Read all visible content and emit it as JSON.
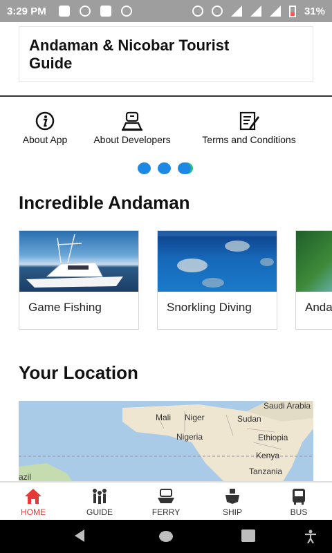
{
  "status_bar": {
    "time": "3:29 PM",
    "battery": "31%"
  },
  "header": {
    "title_line1": "Andaman & Nicobar Tourist",
    "title_line2": "Guide"
  },
  "quick_links": [
    {
      "label": "About App",
      "icon": "info-icon"
    },
    {
      "label": "About Developers",
      "icon": "developer-icon"
    },
    {
      "label": "Terms and Conditions",
      "icon": "document-edit-icon"
    }
  ],
  "pager": {
    "dot_count": 3
  },
  "sections": {
    "incredible": "Incredible Andaman",
    "location": "Your Location"
  },
  "cards": [
    {
      "label": "Game Fishing"
    },
    {
      "label": "Snorkling Diving"
    },
    {
      "label": "Anda"
    }
  ],
  "map": {
    "labels": [
      "Saudi Arabia",
      "Mali",
      "Niger",
      "Sudan",
      "Nigeria",
      "Ethiopia",
      "Kenya",
      "Tanzania",
      "azil"
    ]
  },
  "bottom_nav": [
    {
      "label": "HOME",
      "icon": "home-icon",
      "active": true
    },
    {
      "label": "GUIDE",
      "icon": "guide-icon",
      "active": false
    },
    {
      "label": "FERRY",
      "icon": "ferry-icon",
      "active": false
    },
    {
      "label": "SHIP",
      "icon": "ship-icon",
      "active": false
    },
    {
      "label": "BUS",
      "icon": "bus-icon",
      "active": false
    }
  ],
  "colors": {
    "accent_active": "#e53935",
    "pager_dot": "#1e88e5",
    "status_bar": "#9e9e9e"
  }
}
